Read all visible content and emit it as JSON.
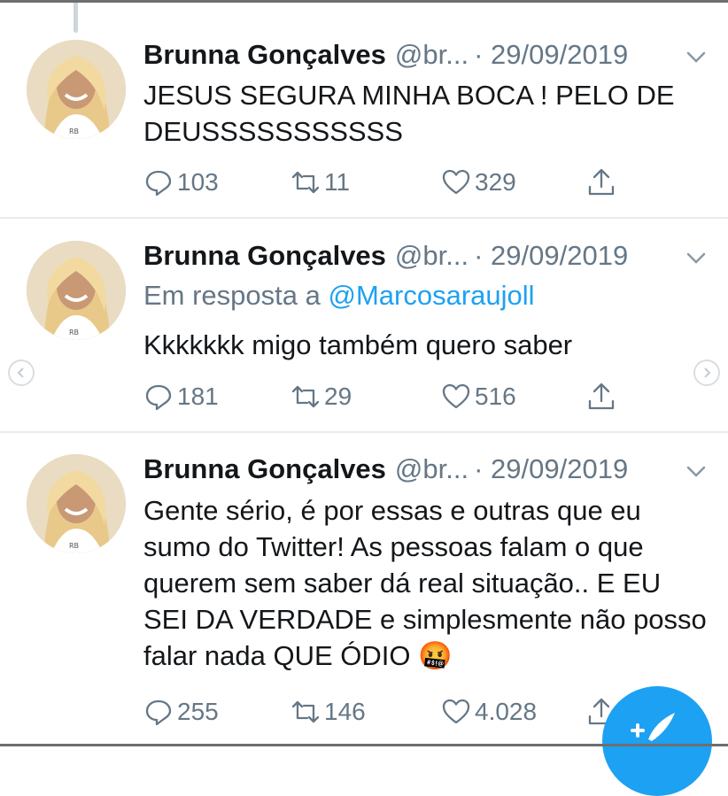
{
  "tweets": [
    {
      "name": "Brunna Gonçalves",
      "handle": "@br...",
      "date": "· 29/09/2019",
      "reply_to_prefix": "",
      "reply_to_handle": "",
      "text": "JESUS SEGURA MINHA BOCA ! PELO DE DEUSSSSSSSSSSS",
      "replies": "103",
      "retweets": "11",
      "likes": "329"
    },
    {
      "name": "Brunna Gonçalves",
      "handle": "@br...",
      "date": "· 29/09/2019",
      "reply_to_prefix": "Em resposta a",
      "reply_to_handle": "@Marcosaraujoll",
      "text": "Kkkkkkk migo também quero saber",
      "replies": "181",
      "retweets": "29",
      "likes": "516"
    },
    {
      "name": "Brunna Gonçalves",
      "handle": "@br...",
      "date": "· 29/09/2019",
      "reply_to_prefix": "",
      "reply_to_handle": "",
      "text": "Gente sério, é por essas e outras que eu sumo do Twitter! As pessoas falam o que querem sem saber dá real situação.. E EU SEI DA VERDADE e simplesmente não posso falar nada QUE ÓDIO 🤬",
      "replies": "255",
      "retweets": "146",
      "likes": "4.028"
    }
  ],
  "icons": {
    "reply": "reply-icon",
    "retweet": "retweet-icon",
    "like": "heart-icon",
    "share": "share-icon",
    "more": "chevron-down-icon",
    "compose": "compose-tweet-icon"
  },
  "colors": {
    "accent": "#1da1f2",
    "muted_text": "#657786",
    "text": "#14171a",
    "divider": "#e6ecf0"
  }
}
